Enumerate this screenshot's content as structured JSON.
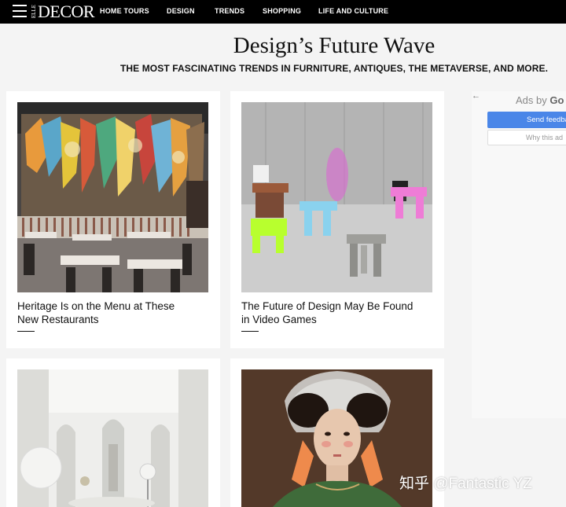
{
  "nav": {
    "logo_small": "ELLE",
    "logo_main": "DECOR",
    "items": [
      "HOME TOURS",
      "DESIGN",
      "TRENDS",
      "SHOPPING",
      "LIFE AND CULTURE"
    ]
  },
  "page": {
    "title": "Design’s Future Wave",
    "subtitle": "THE MOST FASCINATING TRENDS IN FURNITURE, ANTIQUES, THE METAVERSE, AND MORE."
  },
  "cards": [
    {
      "title": "Heritage Is on the Menu at These New Restaurants"
    },
    {
      "title": "The Future of Design May Be Found in Video Games"
    },
    {
      "title": ""
    },
    {
      "title": ""
    }
  ],
  "ads": {
    "arrow": "←",
    "ads_by": "Ads by",
    "brand": "Go",
    "send_feedback": "Send feedba",
    "why_this_ad": "Why this ad"
  },
  "watermark": "知乎 @Fantastic YZ",
  "colors": {
    "nav_bg": "#000000",
    "page_bg": "#f4f4f4",
    "feedback_blue": "#4a86e8"
  },
  "icons": [
    "menu-icon",
    "back-arrow-icon"
  ]
}
